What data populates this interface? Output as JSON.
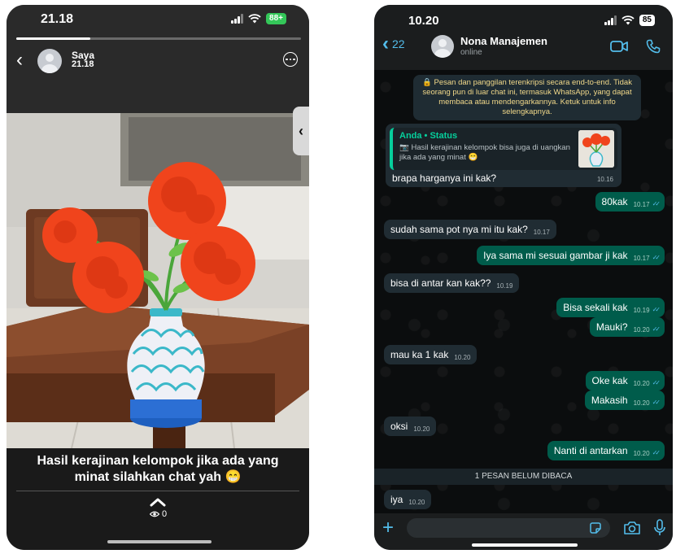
{
  "status_viewer": {
    "status_bar": {
      "time": "21.18",
      "battery": "88+"
    },
    "progress": 0.26,
    "header": {
      "name": "Saya",
      "time": "21.18"
    },
    "caption": "Hasil kerajinan kelompok jika ada yang minat silahkan chat yah 😁",
    "views": "0",
    "colors": {
      "battery": "#34c759",
      "background": "#1c1c1c"
    }
  },
  "chat": {
    "status_bar": {
      "time": "10.20",
      "battery": "85"
    },
    "header": {
      "back_count": "22",
      "contact_name": "Nona Manajemen",
      "presence": "online"
    },
    "encryption_notice": "🔒 Pesan dan panggilan terenkripsi secara end-to-end. Tidak seorang pun di luar chat ini, termasuk WhatsApp, yang dapat membaca atau mendengarkannya. Ketuk untuk info selengkapnya.",
    "reply": {
      "quote_title": "Anda • Status",
      "quote_text": "📷 Hasil kerajinan kelompok bisa juga di uangkan jika ada yang minat 😁",
      "text": "brapa harganya ini kak?",
      "time": "10.16"
    },
    "messages": [
      {
        "dir": "out",
        "text": "80kak",
        "time": "10.17"
      },
      {
        "dir": "in",
        "text": "sudah sama pot nya mi itu kak?",
        "time": "10.17"
      },
      {
        "dir": "out",
        "text": "Iya sama mi sesuai gambar ji kak",
        "time": "10.17"
      },
      {
        "dir": "in",
        "text": "bisa di antar kan kak??",
        "time": "10.19"
      },
      {
        "dir": "out",
        "text": "Bisa sekali kak",
        "time": "10.19"
      },
      {
        "dir": "out",
        "text": "Mauki?",
        "time": "10.20"
      },
      {
        "dir": "in",
        "text": "mau ka 1 kak",
        "time": "10.20"
      },
      {
        "dir": "out",
        "text": "Oke kak",
        "time": "10.20"
      },
      {
        "dir": "out",
        "text": "Makasih",
        "time": "10.20"
      },
      {
        "dir": "in",
        "text": "oksi",
        "time": "10.20"
      },
      {
        "dir": "out",
        "text": "Nanti di antarkan",
        "time": "10.20"
      },
      {
        "dir": "in",
        "text": "iya",
        "time": "10.20"
      }
    ],
    "unread_label": "1 PESAN BELUM DIBACA",
    "input": {
      "value": ""
    },
    "colors": {
      "accent": "#53bdeb",
      "outgoing": "#005c4b",
      "incoming": "#202c33",
      "quote_accent": "#06cf9c"
    },
    "icons": [
      "video-call-icon",
      "phone-icon",
      "plus-icon",
      "sticker-icon",
      "camera-icon",
      "microphone-icon"
    ]
  }
}
